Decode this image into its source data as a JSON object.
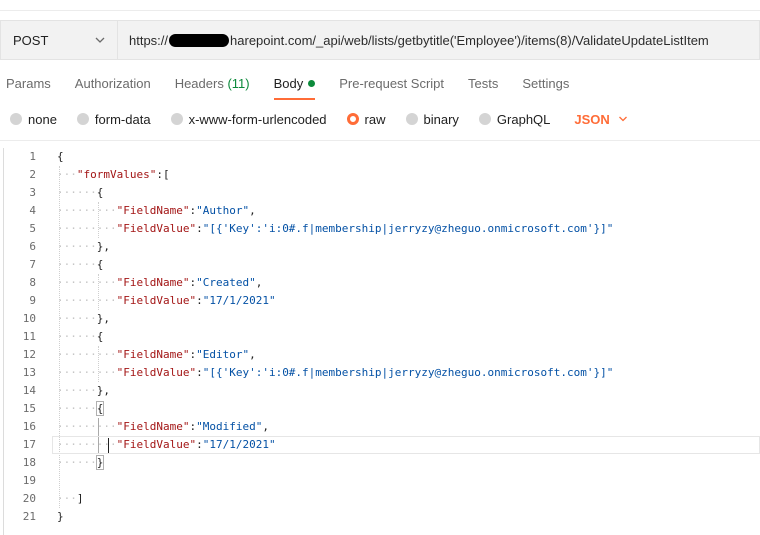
{
  "request": {
    "method": "POST",
    "url_prefix": "https://",
    "url_suffix": "harepoint.com/_api/web/lists/getbytitle('Employee')/items(8)/ValidateUpdateListItem"
  },
  "tabs": [
    {
      "label": "Params"
    },
    {
      "label": "Authorization"
    },
    {
      "label": "Headers",
      "count": "(11)"
    },
    {
      "label": "Body"
    },
    {
      "label": "Pre-request Script"
    },
    {
      "label": "Tests"
    },
    {
      "label": "Settings"
    }
  ],
  "body_options": [
    "none",
    "form-data",
    "x-www-form-urlencoded",
    "raw",
    "binary",
    "GraphQL"
  ],
  "selected_body_option": "raw",
  "format": "JSON",
  "colors": {
    "accent": "#ff6c37",
    "active_dot": "#0c8a3b",
    "json_key": "#a31515",
    "json_string": "#0451a5"
  },
  "editor": {
    "line_numbers": [
      "1",
      "2",
      "3",
      "4",
      "5",
      "6",
      "7",
      "8",
      "9",
      "10",
      "11",
      "12",
      "13",
      "14",
      "15",
      "16",
      "17",
      "18",
      "19",
      "20",
      "21"
    ],
    "open_brace": "{",
    "close_brace": "}",
    "form_values_key": "\"formValues\"",
    "form_values_tail": ":[",
    "array_close": "]",
    "obj_open": "{",
    "obj_close": "},",
    "obj_close_last": "}",
    "items": [
      {
        "k1": "\"FieldName\"",
        "v1": "\"Author\"",
        "k2": "\"FieldValue\"",
        "v2": "\"[{'Key':'i:0#.f|membership|jerryzy@zheguo.onmicrosoft.com'}]\""
      },
      {
        "k1": "\"FieldName\"",
        "v1": "\"Created\"",
        "k2": "\"FieldValue\"",
        "v2": "\"17/1/2021\""
      },
      {
        "k1": "\"FieldName\"",
        "v1": "\"Editor\"",
        "k2": "\"FieldValue\"",
        "v2": "\"[{'Key':'i:0#.f|membership|jerryzy@zheguo.onmicrosoft.com'}]\""
      },
      {
        "k1": "\"FieldName\"",
        "v1": "\"Modified\"",
        "k2": "\"FieldValue\"",
        "v2": "\"17/1/2021\""
      }
    ],
    "colon": ":",
    "comma": ","
  }
}
